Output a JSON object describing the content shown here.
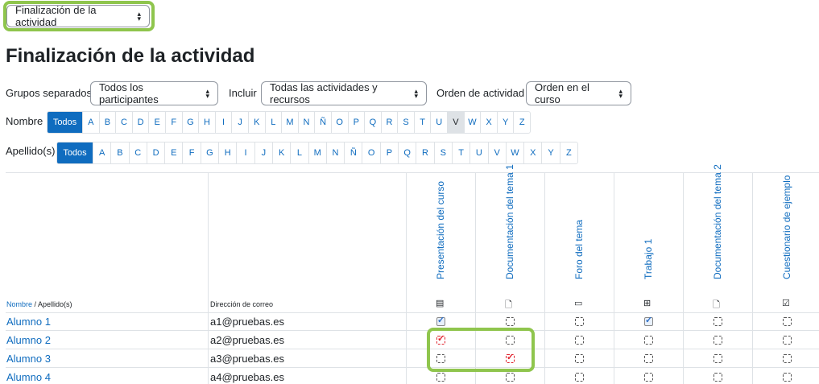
{
  "report_selector": {
    "value": "Finalización de la actividad"
  },
  "page_title": "Finalización de la actividad",
  "filters": {
    "groups_label": "Grupos separados",
    "groups_value": "Todos los participantes",
    "include_label": "Incluir",
    "include_value": "Todas las actividades y recursos",
    "order_label": "Orden de actividad",
    "order_value": "Orden en el curso"
  },
  "name_filter": {
    "label": "Nombre",
    "all": "Todos",
    "selected": "V"
  },
  "surname_filter": {
    "label": "Apellido(s)",
    "all": "Todos"
  },
  "letters": [
    "A",
    "B",
    "C",
    "D",
    "E",
    "F",
    "G",
    "H",
    "I",
    "J",
    "K",
    "L",
    "M",
    "N",
    "Ñ",
    "O",
    "P",
    "Q",
    "R",
    "S",
    "T",
    "U",
    "V",
    "W",
    "X",
    "Y",
    "Z"
  ],
  "table": {
    "sort_first": "Nombre",
    "sort_sep": " / ",
    "sort_last": "Apellido(s)",
    "email_header": "Dirección de correo",
    "activities": [
      {
        "name": "Presentación del curso",
        "icon": "page-icon"
      },
      {
        "name": "Documentación del tema 1",
        "icon": "file-icon"
      },
      {
        "name": "Foro del tema",
        "icon": "forum-icon"
      },
      {
        "name": "Trabajo 1",
        "icon": "assignment-icon"
      },
      {
        "name": "Documentación del tema 2",
        "icon": "file-icon"
      },
      {
        "name": "Cuestionario de ejemplo",
        "icon": "quiz-icon"
      }
    ],
    "rows": [
      {
        "name": "Alumno 1",
        "email": "a1@pruebas.es",
        "status": [
          "done",
          "empty",
          "empty",
          "done",
          "empty",
          "empty"
        ]
      },
      {
        "name": "Alumno 2",
        "email": "a2@pruebas.es",
        "status": [
          "manual",
          "empty",
          "empty",
          "empty",
          "empty",
          "empty"
        ]
      },
      {
        "name": "Alumno 3",
        "email": "a3@pruebas.es",
        "status": [
          "empty",
          "manual",
          "empty",
          "empty",
          "empty",
          "empty"
        ]
      },
      {
        "name": "Alumno 4",
        "email": "a4@pruebas.es",
        "status": [
          "empty",
          "empty",
          "empty",
          "empty",
          "empty",
          "empty"
        ]
      }
    ]
  },
  "colors": {
    "link": "#0f6cbf",
    "highlight": "#8fc54d",
    "check_blue": "#2f6fc6",
    "manual_red": "#e0242f"
  }
}
